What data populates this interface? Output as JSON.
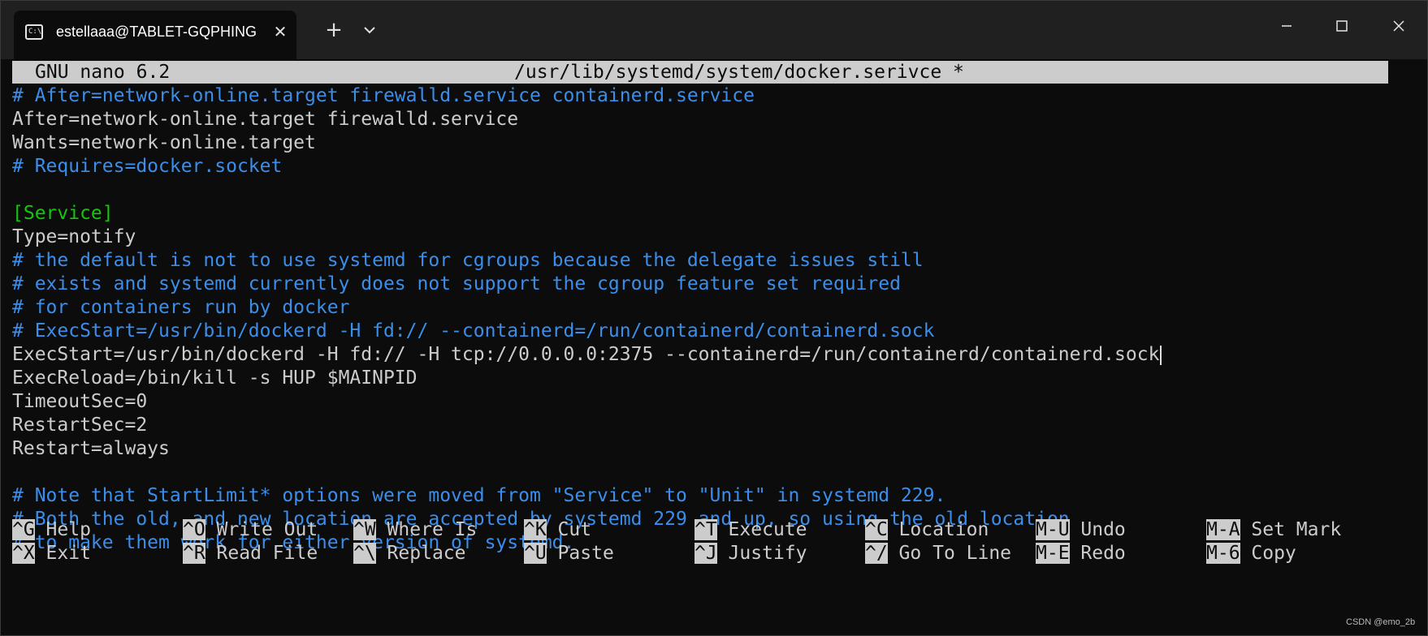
{
  "window": {
    "tab_title": "estellaaa@TABLET-GQPHINGF",
    "tab_icon": "terminal-icon",
    "new_tab_symbol": "+",
    "close_symbol": "✕"
  },
  "nano": {
    "version": "GNU nano 6.2",
    "filename": "/usr/lib/systemd/system/docker.serivce *"
  },
  "lines": [
    {
      "text": "# After=network-online.target firewalld.service containerd.service",
      "kind": "comment"
    },
    {
      "text": "After=network-online.target firewalld.service",
      "kind": "plain"
    },
    {
      "text": "Wants=network-online.target",
      "kind": "plain"
    },
    {
      "text": "# Requires=docker.socket",
      "kind": "comment"
    },
    {
      "text": "",
      "kind": "plain"
    },
    {
      "text": "[Service]",
      "kind": "section"
    },
    {
      "text": "Type=notify",
      "kind": "plain"
    },
    {
      "text": "# the default is not to use systemd for cgroups because the delegate issues still",
      "kind": "comment"
    },
    {
      "text": "# exists and systemd currently does not support the cgroup feature set required",
      "kind": "comment"
    },
    {
      "text": "# for containers run by docker",
      "kind": "comment"
    },
    {
      "text": "# ExecStart=/usr/bin/dockerd -H fd:// --containerd=/run/containerd/containerd.sock",
      "kind": "comment"
    },
    {
      "text": "ExecStart=/usr/bin/dockerd -H fd:// -H tcp://0.0.0.0:2375 --containerd=/run/containerd/containerd.sock",
      "kind": "plain"
    },
    {
      "text": "ExecReload=/bin/kill -s HUP $MAINPID",
      "kind": "plain"
    },
    {
      "text": "TimeoutSec=0",
      "kind": "plain"
    },
    {
      "text": "RestartSec=2",
      "kind": "plain"
    },
    {
      "text": "Restart=always",
      "kind": "plain"
    },
    {
      "text": "",
      "kind": "plain"
    },
    {
      "text": "# Note that StartLimit* options were moved from \"Service\" to \"Unit\" in systemd 229.",
      "kind": "comment"
    },
    {
      "text": "# Both the old, and new location are accepted by systemd 229 and up, so using the old location",
      "kind": "comment"
    },
    {
      "text": "# to make them work for either version of systemd.",
      "kind": "comment"
    }
  ],
  "shortcuts": [
    {
      "key": "^G",
      "label": "Help"
    },
    {
      "key": "^O",
      "label": "Write Out"
    },
    {
      "key": "^W",
      "label": "Where Is"
    },
    {
      "key": "^K",
      "label": "Cut"
    },
    {
      "key": "^T",
      "label": "Execute"
    },
    {
      "key": "^C",
      "label": "Location"
    },
    {
      "key": "M-U",
      "label": "Undo"
    },
    {
      "key": "M-A",
      "label": "Set Mark"
    },
    {
      "key": "^X",
      "label": "Exit"
    },
    {
      "key": "^R",
      "label": "Read File"
    },
    {
      "key": "^\\",
      "label": "Replace"
    },
    {
      "key": "^U",
      "label": "Paste"
    },
    {
      "key": "^J",
      "label": "Justify"
    },
    {
      "key": "^/",
      "label": "Go To Line"
    },
    {
      "key": "M-E",
      "label": "Redo"
    },
    {
      "key": "M-6",
      "label": "Copy"
    }
  ],
  "watermark": "CSDN @emo_2b",
  "colors": {
    "comment": "#3b8eea",
    "section": "#16c60c",
    "text": "#cccccc",
    "background": "#0c0c0c"
  }
}
